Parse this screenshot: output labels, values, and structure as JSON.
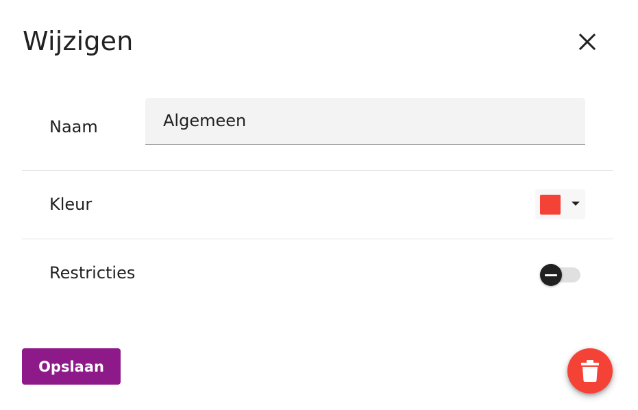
{
  "dialog": {
    "title": "Wijzigen",
    "close_icon": "close-icon"
  },
  "name_row": {
    "label": "Naam",
    "value": "Algemeen"
  },
  "color_row": {
    "label": "Kleur",
    "selected_color": "#f44336",
    "caret_icon": "caret-down-icon"
  },
  "restrictions_row": {
    "label": "Restricties",
    "enabled": false,
    "knob_icon": "minus-icon"
  },
  "actions": {
    "save_label": "Opslaan",
    "save_color": "#8e1a8a",
    "delete_icon": "trash-icon",
    "delete_color": "#f44336"
  }
}
